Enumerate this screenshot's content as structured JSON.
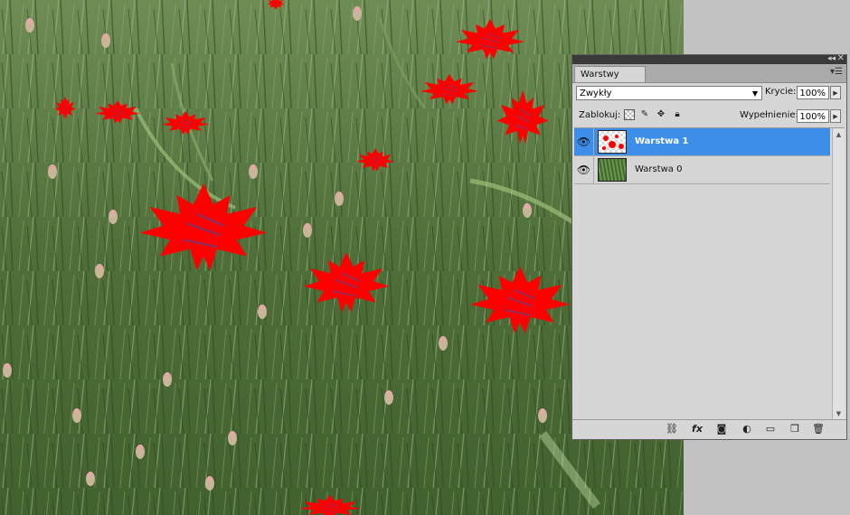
{
  "panel": {
    "tab_label": "Warstwy",
    "blend_mode": "Zwykły",
    "opacity_label": "Krycie:",
    "opacity_value": "100%",
    "lock_label": "Zablokuj:",
    "fill_label": "Wypełnienie:",
    "fill_value": "100%",
    "layers": [
      {
        "name": "Warstwa 1",
        "selected": true,
        "visible": true
      },
      {
        "name": "Warstwa 0",
        "selected": false,
        "visible": true
      }
    ],
    "selection_color": "#3d8ee9"
  },
  "icons": {
    "lock_transparency": "checker-icon",
    "lock_image": "brush-icon",
    "lock_position": "move-icon",
    "lock_all": "lock-icon",
    "bottom": [
      "link-icon",
      "fx-icon",
      "mask-icon",
      "adjustment-icon",
      "folder-icon",
      "new-layer-icon",
      "trash-icon"
    ]
  }
}
